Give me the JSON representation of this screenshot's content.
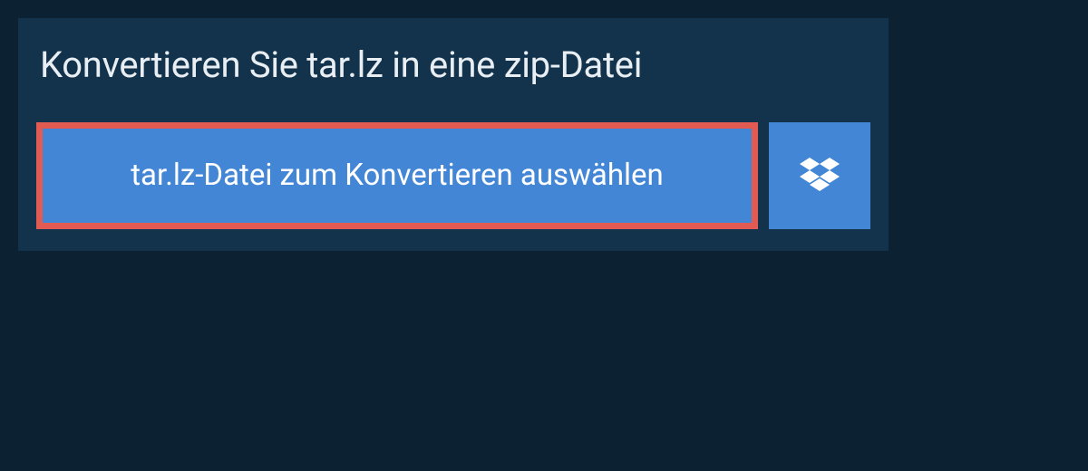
{
  "panel": {
    "title": "Konvertieren Sie tar.lz in eine zip-Datei",
    "selectFileLabel": "tar.lz-Datei zum Konvertieren auswählen"
  }
}
